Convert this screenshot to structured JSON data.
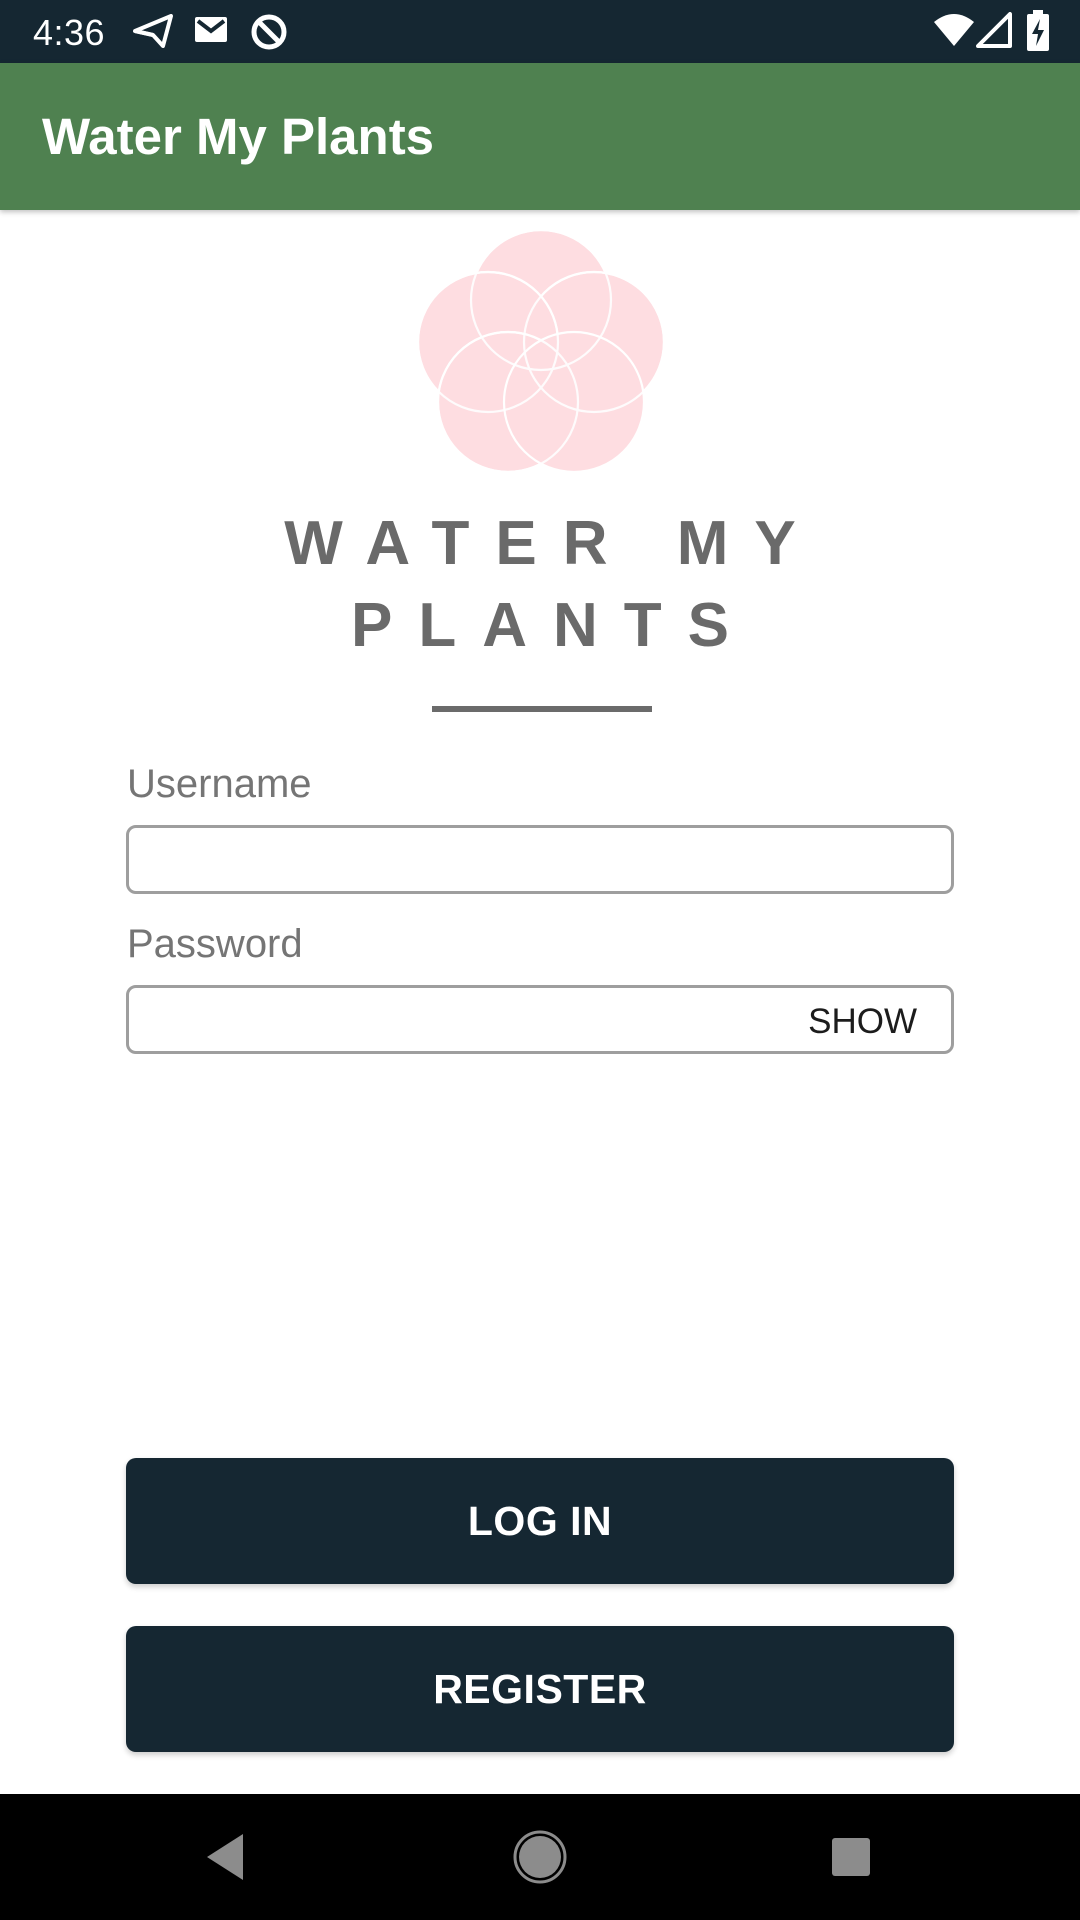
{
  "status_bar": {
    "time": "4:36",
    "left_icons": [
      "send-icon",
      "gmail-icon",
      "data-saver-icon"
    ],
    "right_icons": [
      "wifi-icon",
      "cell-signal-icon",
      "battery-charging-icon"
    ]
  },
  "app_bar": {
    "title": "Water My Plants",
    "color": "#4f8150"
  },
  "logo": {
    "line1": "WATER MY",
    "line2": "PLANTS",
    "flower_color": "#fedde1"
  },
  "form": {
    "username_label": "Username",
    "username_value": "",
    "password_label": "Password",
    "password_value": "",
    "show_label": "SHOW"
  },
  "buttons": {
    "login_label": "LOG IN",
    "register_label": "REGISTER",
    "color": "#152732"
  },
  "nav_bar": {
    "icons": [
      "back-icon",
      "home-icon",
      "recents-icon"
    ]
  }
}
